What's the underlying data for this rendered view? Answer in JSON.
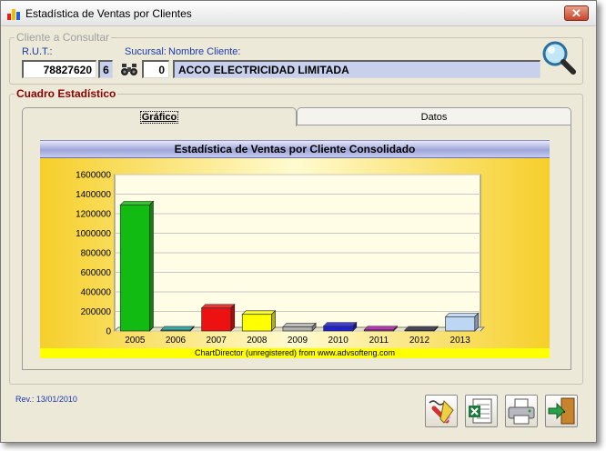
{
  "window": {
    "title": "Estadística de Ventas por Clientes",
    "close_label": "✕"
  },
  "client_group": {
    "legend": "Cliente a Consultar",
    "rut_label": "R.U.T.:",
    "sucursal_label": "Sucursal:",
    "nombre_label": "Nombre Cliente:",
    "rut_value": "78827620",
    "dv_value": "6",
    "sucursal_value": "0",
    "cliente_value": "ACCO ELECTRICIDAD LIMITADA"
  },
  "stats_group": {
    "legend": "Cuadro Estadístico",
    "tabs": [
      {
        "label": "Gráfico"
      },
      {
        "label": "Datos"
      }
    ]
  },
  "chart_footer": "ChartDirector (unregistered) from www.advsofteng.com",
  "chart_data": {
    "type": "bar",
    "title": "Estadística de Ventas por Cliente Consolidado",
    "categories": [
      "2005",
      "2006",
      "2007",
      "2008",
      "2009",
      "2010",
      "2011",
      "2012",
      "2013"
    ],
    "values": [
      1290000,
      6000,
      235000,
      170000,
      42000,
      50000,
      12000,
      9000,
      145000
    ],
    "colors": [
      "#11bb11",
      "#20a6a6",
      "#ee1111",
      "#ffff00",
      "#b0b0b0",
      "#2020d0",
      "#b020b0",
      "#303050",
      "#bcd6f4"
    ],
    "yticks": [
      0,
      200000,
      400000,
      600000,
      800000,
      1000000,
      1200000,
      1400000,
      1600000
    ],
    "ylim": [
      0,
      1600000
    ],
    "xlabel": "",
    "ylabel": ""
  },
  "footer": {
    "revision": "Rev.: 13/01/2010"
  },
  "icons": {
    "app": "chart-app-icon",
    "binoculars": "binoculars-icon",
    "search": "magnifier-icon",
    "edit": "pencil-eraser-icon",
    "excel": "excel-icon",
    "print": "printer-icon",
    "exit": "exit-door-icon"
  }
}
